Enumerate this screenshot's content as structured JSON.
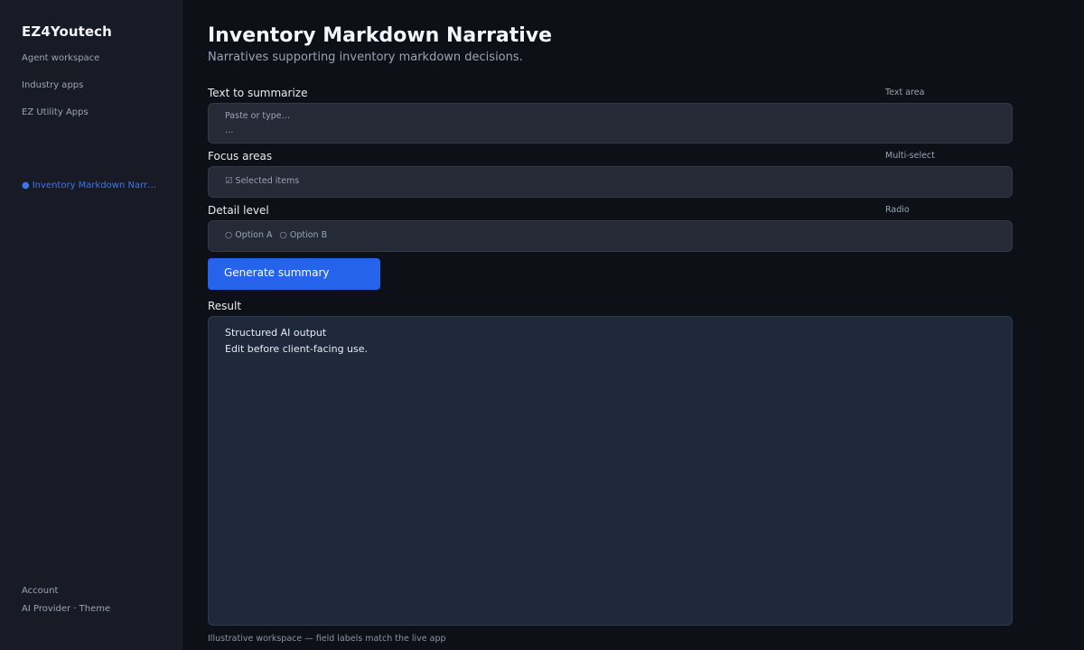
{
  "sidebar": {
    "brand": "EZ4Youtech",
    "links": {
      "agent_workspace": "Agent workspace",
      "industry_apps": "Industry apps",
      "utility_apps": "EZ Utility Apps"
    },
    "active_item": {
      "bullet": "●",
      "label": "Inventory Markdown Narrative"
    },
    "footer": {
      "account": "Account",
      "provider_theme": "AI Provider · Theme"
    }
  },
  "main": {
    "title": "Inventory Markdown Narrative",
    "subtitle": "Narratives supporting inventory markdown decisions.",
    "fields": {
      "text": {
        "label": "Text to summarize",
        "type": "Text area",
        "placeholder": "Paste or type…",
        "placeholder_ellipsis": "…"
      },
      "focus": {
        "label": "Focus areas",
        "type": "Multi-select",
        "value": "☑ Selected items"
      },
      "detail": {
        "label": "Detail level",
        "type": "Radio",
        "option_a": "○ Option A",
        "option_b": "○ Option B"
      }
    },
    "generate_button": "Generate summary",
    "result": {
      "label": "Result",
      "line1": "Structured AI output",
      "line2": "Edit before client-facing use."
    },
    "footer_note": "Illustrative workspace — field labels match the live app"
  },
  "colors": {
    "accent": "#2563eb",
    "active_nav": "#3b76f0",
    "background": "#0d1017",
    "sidebar": "#181b26"
  }
}
